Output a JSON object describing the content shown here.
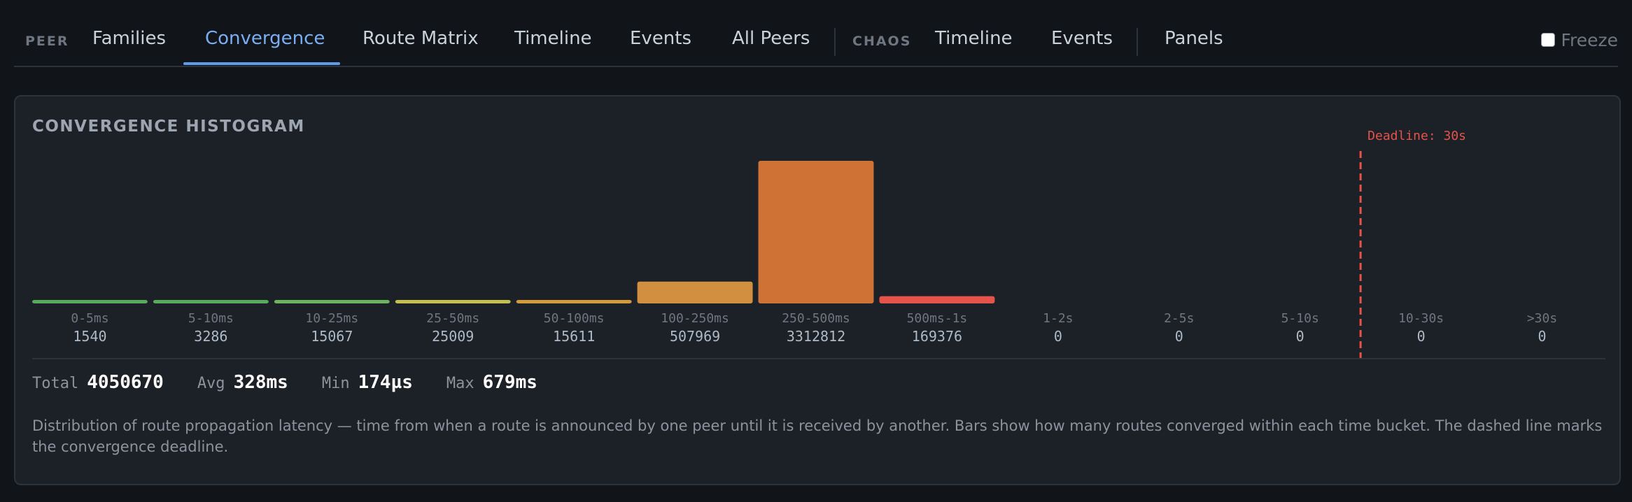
{
  "nav": {
    "peer_section": "PEER",
    "peer_tabs": [
      {
        "label": "Families"
      },
      {
        "label": "Convergence"
      },
      {
        "label": "Route Matrix"
      },
      {
        "label": "Timeline"
      },
      {
        "label": "Events"
      },
      {
        "label": "All Peers"
      }
    ],
    "active_tab": "Convergence",
    "chaos_section": "CHAOS",
    "chaos_tabs": [
      {
        "label": "Timeline"
      },
      {
        "label": "Events"
      }
    ],
    "other_tabs": [
      {
        "label": "Panels"
      }
    ],
    "freeze_label": "Freeze",
    "freeze_checked": false
  },
  "panel": {
    "title": "CONVERGENCE HISTOGRAM",
    "deadline_label": "Deadline: 30s",
    "stats": {
      "total_label": "Total",
      "total_value": "4050670",
      "avg_label": "Avg",
      "avg_value": "328ms",
      "min_label": "Min",
      "min_value": "174µs",
      "max_label": "Max",
      "max_value": "679ms"
    },
    "description": "Distribution of route propagation latency — time from when a route is announced by one peer until it is received by another. Bars show how many routes converged within each time bucket. The dashed line marks the convergence deadline."
  },
  "colors": {
    "accent": "#79aef2",
    "deadline": "#e5534b",
    "panel_bg": "#1c2027",
    "page_bg": "#111419"
  },
  "chart_data": {
    "type": "bar",
    "title": "CONVERGENCE HISTOGRAM",
    "categories": [
      "0-5ms",
      "5-10ms",
      "10-25ms",
      "25-50ms",
      "50-100ms",
      "100-250ms",
      "250-500ms",
      "500ms-1s",
      "1-2s",
      "2-5s",
      "5-10s",
      "10-30s",
      ">30s"
    ],
    "values": [
      1540,
      3286,
      15067,
      25009,
      15611,
      507969,
      3312812,
      169376,
      0,
      0,
      0,
      0,
      0
    ],
    "colors": [
      "#57ab5a",
      "#57ab5a",
      "#6bb55c",
      "#c5c04e",
      "#d39a3a",
      "#d28f40",
      "#cf7236",
      "#e5534b",
      "#57ab5a",
      "#57ab5a",
      "#57ab5a",
      "#57ab5a",
      "#57ab5a"
    ],
    "deadline": {
      "bucket": "10-30s",
      "label": "Deadline: 30s",
      "style": "dashed"
    },
    "grid": false,
    "legend": "none"
  }
}
